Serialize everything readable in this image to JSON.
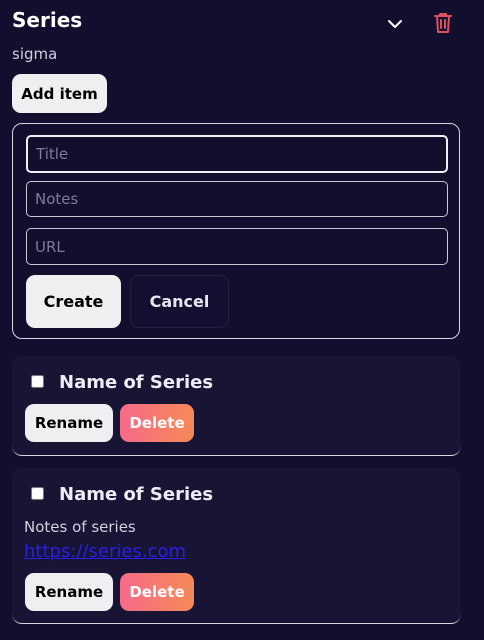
{
  "header": {
    "title": "Series",
    "subtitle": "sigma",
    "chevron_icon": "chevron-down-icon",
    "trash_icon": "trash-icon",
    "trash_color": "#e0505c"
  },
  "toolbar": {
    "add_item_label": "Add item"
  },
  "form": {
    "title_placeholder": "Title",
    "notes_placeholder": "Notes",
    "url_placeholder": "URL",
    "create_label": "Create",
    "cancel_label": "Cancel"
  },
  "items": [
    {
      "name": "Name of Series",
      "checked": false,
      "notes": "",
      "url": "",
      "rename_label": "Rename",
      "delete_label": "Delete"
    },
    {
      "name": "Name of Series",
      "checked": false,
      "notes": "Notes of series",
      "url": "https://series.com",
      "rename_label": "Rename",
      "delete_label": "Delete"
    }
  ],
  "colors": {
    "background": "#110e2e",
    "card_background": "#181434",
    "delete_gradient_start": "#f76a8a",
    "delete_gradient_end": "#f58a56",
    "link": "#2a1fe8"
  }
}
